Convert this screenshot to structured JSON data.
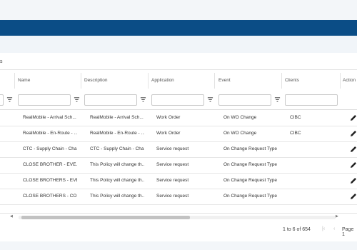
{
  "section": {
    "label": "s"
  },
  "columns": [
    {
      "label": ""
    },
    {
      "label": "Name"
    },
    {
      "label": "Description"
    },
    {
      "label": "Application"
    },
    {
      "label": "Event"
    },
    {
      "label": "Clients"
    },
    {
      "label": "Action"
    }
  ],
  "rows": [
    {
      "name": "RealMobile - Arrival Sch...",
      "description": "RealMobile - Arrival Sch...",
      "application": "Work Order",
      "event": "On WO Change",
      "clients": "CIBC"
    },
    {
      "name": "RealMobile - En-Route - ...",
      "description": "RealMobile - En-Route - ...",
      "application": "Work Order",
      "event": "On WO Change",
      "clients": "CIBC"
    },
    {
      "name": "CTC - Supply Chain - Cha...",
      "description": "CTC - Supply Chain - Cha...",
      "application": "Service request",
      "event": "On Change Request Type",
      "clients": ""
    },
    {
      "name": "CLOSE BROTHER - EVE...",
      "description": "This Policy will change th...",
      "application": "Service request",
      "event": "On Change Request Type",
      "clients": ""
    },
    {
      "name": "CLOSE BROTHERS - EVE...",
      "description": "This Policy will change th...",
      "application": "Service request",
      "event": "On Change Request Type",
      "clients": ""
    },
    {
      "name": "CLOSE BROTHERS - CO...",
      "description": "This Policy will change th...",
      "application": "Service request",
      "event": "On Change Request Type",
      "clients": ""
    }
  ],
  "pagination": {
    "summary": "1 to 6 of 654",
    "page_label": "Page 1"
  },
  "icons": {
    "filter": "filter-icon",
    "edit": "pencil-icon",
    "first_page": "first-page-icon",
    "prev_page": "chevron-left-icon"
  },
  "colors": {
    "navbar": "#0b4d86",
    "header_strip": "#f3f6f9"
  }
}
